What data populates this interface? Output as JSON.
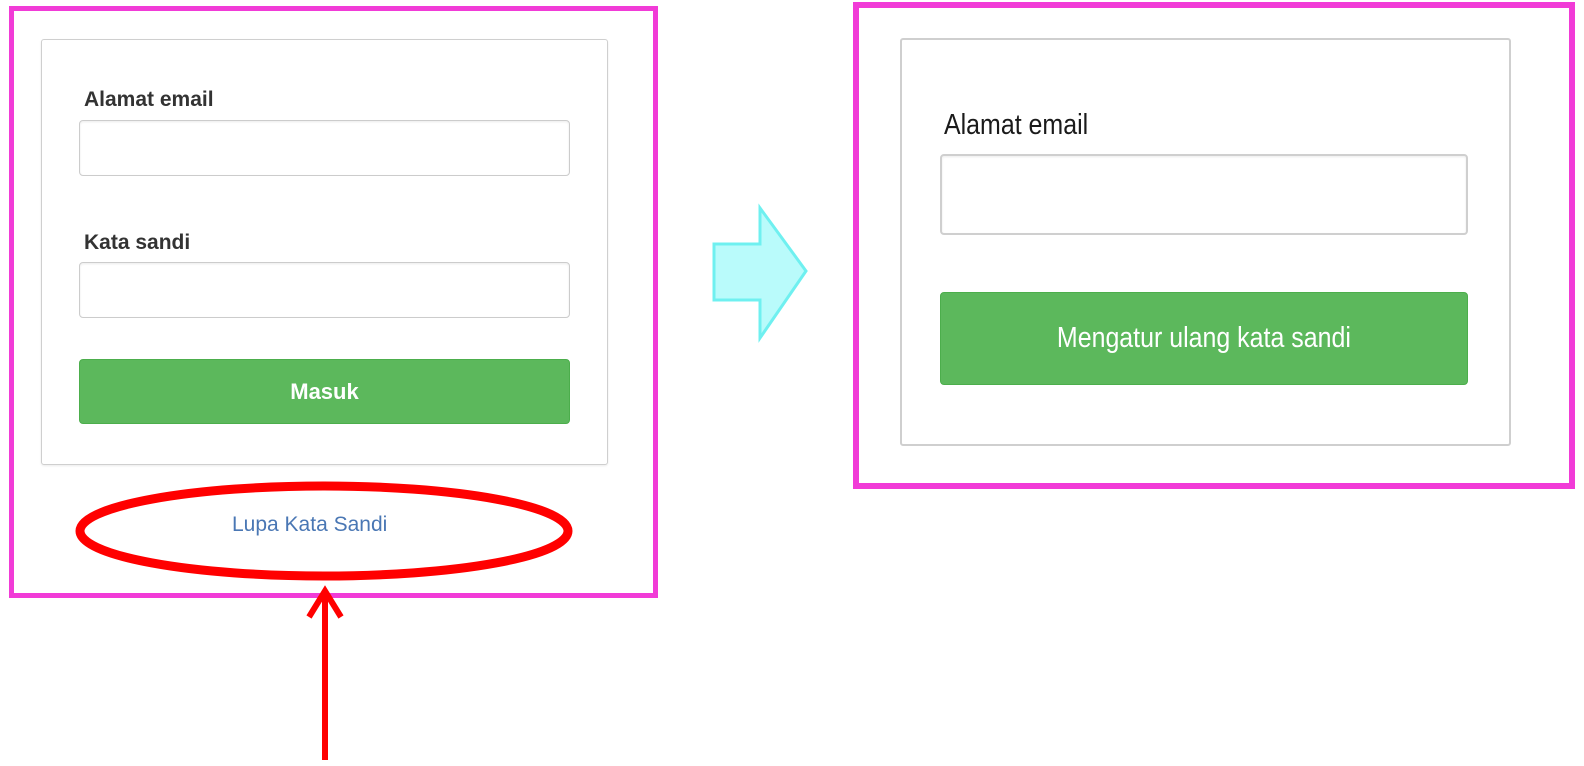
{
  "login_form": {
    "email_label": "Alamat email",
    "email_value": "",
    "password_label": "Kata sandi",
    "password_value": "",
    "submit_label": "Masuk",
    "forgot_link_label": "Lupa Kata Sandi"
  },
  "reset_form": {
    "email_label": "Alamat email",
    "email_value": "",
    "submit_label": "Mengatur ulang kata sandi"
  },
  "annotations": {
    "frame_color": "#f13bd7",
    "highlight_color": "#ff0000",
    "transition_arrow_color": "#b9fbfb",
    "transition_arrow_border": "#6ff0f0",
    "pointer_arrow_icon": "up-arrow-icon",
    "highlight_shape": "ellipse"
  },
  "colors": {
    "button_green": "#5cb85c",
    "link_blue": "#4a77b4"
  }
}
